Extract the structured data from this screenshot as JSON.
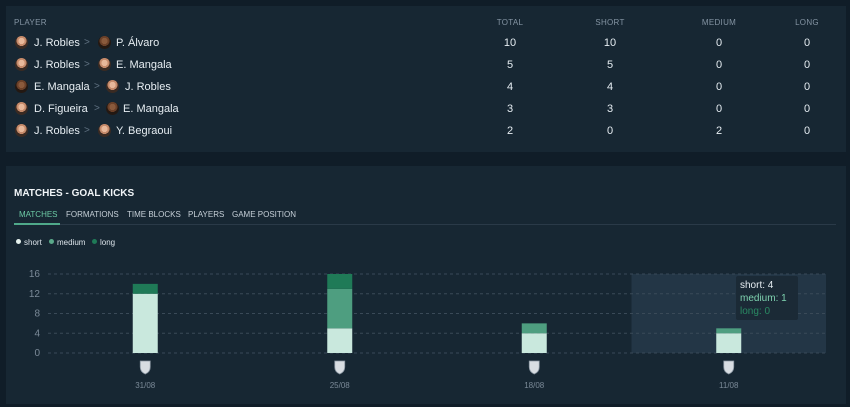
{
  "pairs_table": {
    "headers": {
      "player": "PLAYER",
      "total": "TOTAL",
      "short": "SHORT",
      "medium": "MEDIUM",
      "long": "LONG"
    },
    "separator": ">",
    "rows": [
      {
        "from": "J. Robles",
        "to": "P. Álvaro",
        "total": "10",
        "short": "10",
        "medium": "0",
        "long": "0"
      },
      {
        "from": "J. Robles",
        "to": "E. Mangala",
        "total": "5",
        "short": "5",
        "medium": "0",
        "long": "0"
      },
      {
        "from": "E. Mangala",
        "to": "J. Robles",
        "total": "4",
        "short": "4",
        "medium": "0",
        "long": "0"
      },
      {
        "from": "D. Figueira",
        "to": "E. Mangala",
        "total": "3",
        "short": "3",
        "medium": "0",
        "long": "0"
      },
      {
        "from": "J. Robles",
        "to": "Y. Begraoui",
        "total": "2",
        "short": "0",
        "medium": "2",
        "long": "0"
      }
    ]
  },
  "matches_section": {
    "title": "MATCHES - GOAL KICKS",
    "tabs": [
      {
        "label": "MATCHES",
        "active": true
      },
      {
        "label": "FORMATIONS",
        "active": false
      },
      {
        "label": "TIME BLOCKS",
        "active": false
      },
      {
        "label": "PLAYERS",
        "active": false
      },
      {
        "label": "GAME POSITION",
        "active": false
      }
    ],
    "legend": [
      {
        "label": "short",
        "color": "#e6f2ee"
      },
      {
        "label": "medium",
        "color": "#5aa98a"
      },
      {
        "label": "long",
        "color": "#1f7a57"
      }
    ],
    "tooltip": {
      "short": "short: 4",
      "medium": "medium: 1",
      "long": "long: 0"
    }
  },
  "chart_data": {
    "type": "bar",
    "stacked": true,
    "categories": [
      "31/08",
      "25/08",
      "18/08",
      "11/08"
    ],
    "series": [
      {
        "name": "short",
        "values": [
          12,
          5,
          4,
          4
        ],
        "color": "#c9e8dd"
      },
      {
        "name": "medium",
        "values": [
          0,
          8,
          2,
          1
        ],
        "color": "#4e9e80"
      },
      {
        "name": "long",
        "values": [
          2,
          3,
          0,
          0
        ],
        "color": "#1f7a57"
      }
    ],
    "yticks": [
      0,
      4,
      8,
      12,
      16
    ],
    "ylim": [
      0,
      16
    ],
    "grid": true,
    "highlighted_category": "11/08",
    "category_icons": [
      "club-crest-icon",
      "club-crest-icon",
      "club-crest-icon",
      "club-crest-icon"
    ]
  }
}
